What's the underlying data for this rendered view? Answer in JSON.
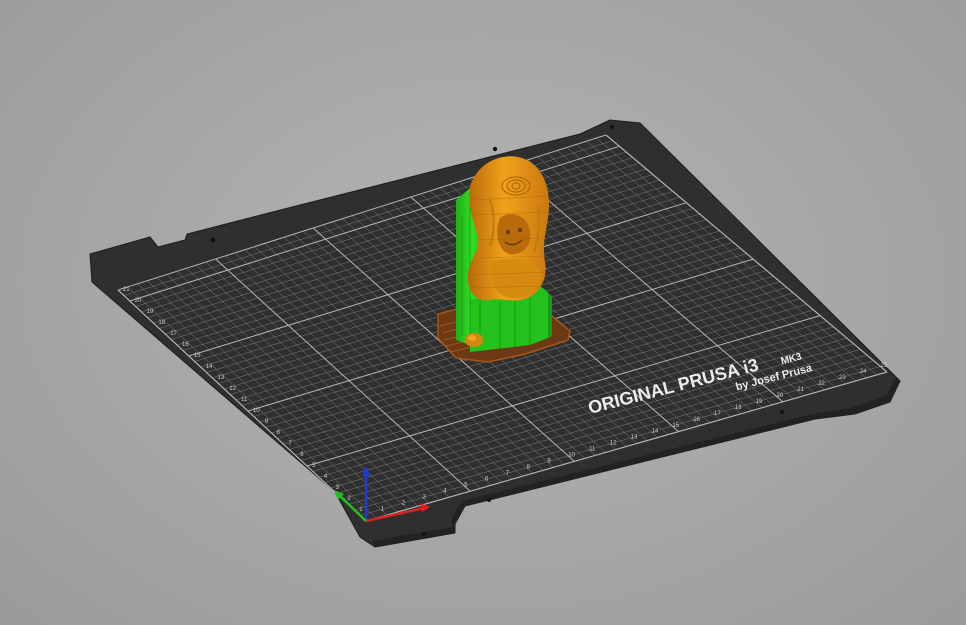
{
  "app": {
    "view": "3D preview",
    "accent": "#ed6b21"
  },
  "bed": {
    "logo_line1": "ORIGINAL PRUSA i3",
    "logo_model": "MK3",
    "logo_line2": "by Josef Prusa",
    "x_ticks": [
      "1",
      "2",
      "3",
      "4",
      "5",
      "6",
      "7",
      "8",
      "9",
      "10",
      "11",
      "12",
      "13",
      "14",
      "15",
      "16",
      "17",
      "18",
      "19",
      "20",
      "21",
      "22",
      "23",
      "24",
      "25"
    ],
    "y_ticks": [
      "1",
      "2",
      "3",
      "4",
      "5",
      "6",
      "7",
      "8",
      "9",
      "10",
      "11",
      "12",
      "13",
      "14",
      "15",
      "16",
      "17",
      "18",
      "19",
      "20",
      "21"
    ],
    "surface_color": "#3a3a3a",
    "grid_color": "#8d8d8d"
  },
  "model": {
    "name": "figurine",
    "colors": {
      "perimeter": "#e8960e",
      "support": "#22d21a",
      "skirt": "#b0631e",
      "shadow": "#6a3a14"
    }
  },
  "axes": {
    "x": {
      "color": "#e02020"
    },
    "y": {
      "color": "#20c020"
    },
    "z": {
      "color": "#1f3bd6"
    }
  }
}
